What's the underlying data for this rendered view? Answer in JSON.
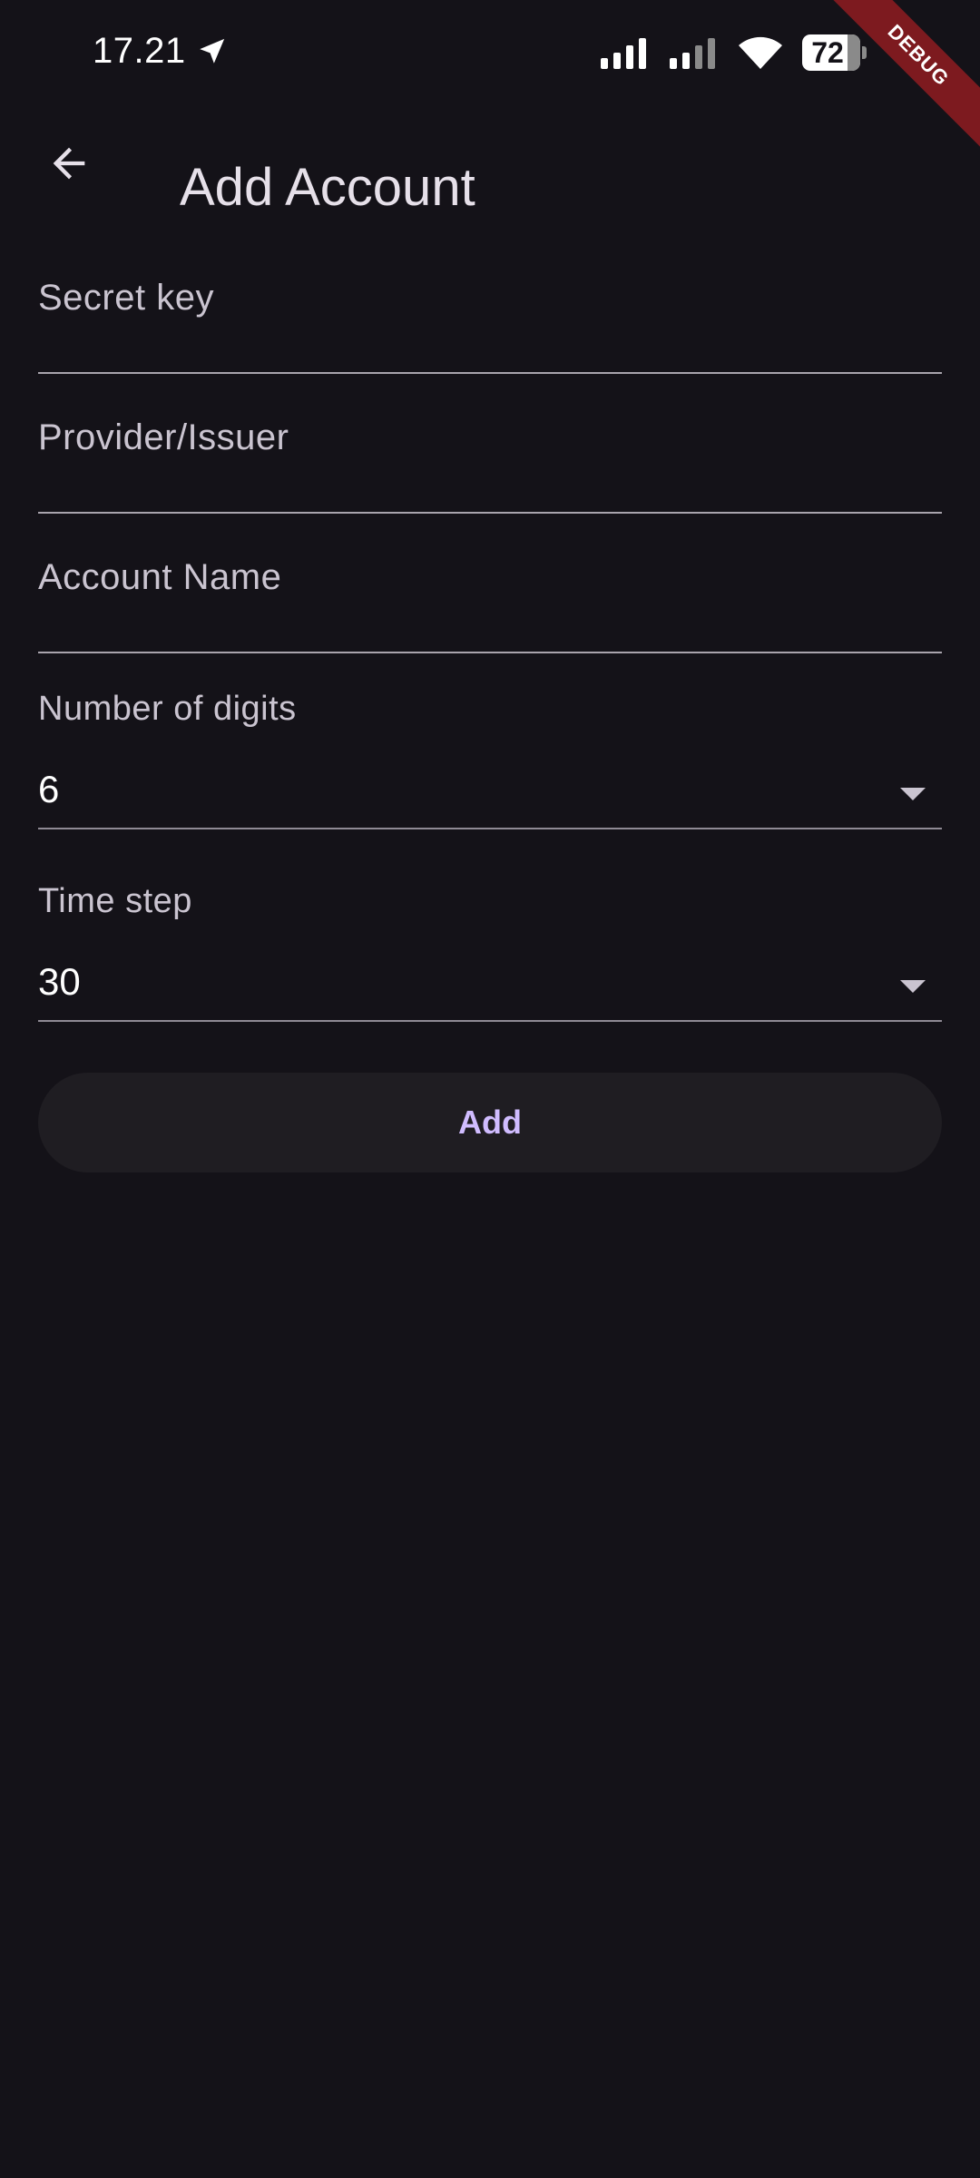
{
  "status_bar": {
    "time": "17.21",
    "battery_percent": "72",
    "icons": [
      "navigation-arrow-icon",
      "signal-icon",
      "signal-icon",
      "wifi-icon",
      "battery-icon"
    ]
  },
  "debug_banner": {
    "label": "DEBUG",
    "color": "#7d1a1f"
  },
  "app_bar": {
    "title": "Add Account",
    "back_icon": "arrow-left-icon"
  },
  "form": {
    "secret_key_label": "Secret key",
    "provider_label": "Provider/Issuer",
    "account_name_label": "Account Name",
    "digits": {
      "label": "Number of digits",
      "value": "6"
    },
    "time_step": {
      "label": "Time step",
      "value": "30"
    }
  },
  "actions": {
    "add_label": "Add"
  },
  "colors": {
    "background": "#141218",
    "accent": "#d0bcff",
    "button_bg": "#1f1d22"
  }
}
